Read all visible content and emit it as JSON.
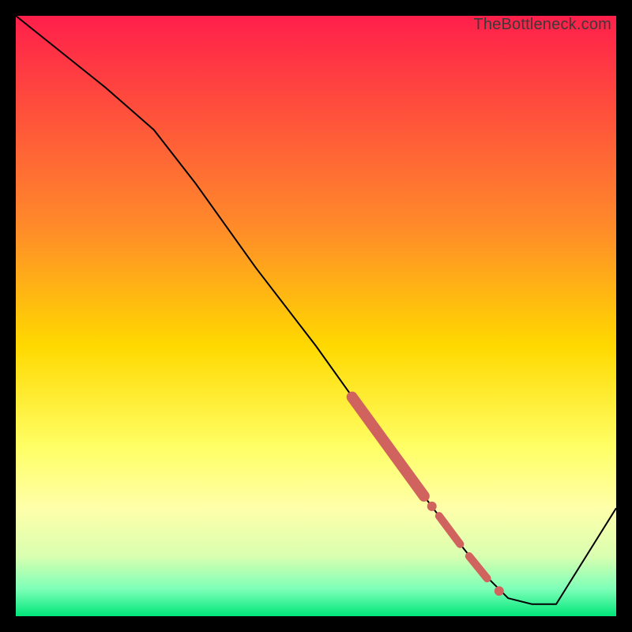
{
  "watermark": "TheBottleneck.com",
  "chart_data": {
    "type": "line",
    "title": "",
    "xlabel": "",
    "ylabel": "",
    "xlim": [
      0,
      100
    ],
    "ylim": [
      0,
      100
    ],
    "gradient_stops": [
      {
        "offset": 0.0,
        "color": "#ff1f4b"
      },
      {
        "offset": 0.35,
        "color": "#ff8a2a"
      },
      {
        "offset": 0.55,
        "color": "#ffd900"
      },
      {
        "offset": 0.72,
        "color": "#ffff66"
      },
      {
        "offset": 0.82,
        "color": "#ffffaa"
      },
      {
        "offset": 0.9,
        "color": "#d9ffb0"
      },
      {
        "offset": 0.955,
        "color": "#7dffb8"
      },
      {
        "offset": 1.0,
        "color": "#00e67a"
      }
    ],
    "series": [
      {
        "name": "bottleneck-curve",
        "color": "#000000",
        "stroke_width": 2,
        "x": [
          0,
          5,
          15,
          23,
          30,
          40,
          50,
          60,
          68,
          74,
          78,
          82,
          86,
          90,
          100
        ],
        "y": [
          100,
          96,
          88,
          81,
          72,
          58,
          45,
          31,
          20,
          12,
          7,
          3,
          2,
          2,
          18
        ]
      }
    ],
    "highlight_segments": [
      {
        "name": "thick-segment",
        "color": "#d1635e",
        "stroke_width": 14,
        "linecap": "round",
        "x": [
          56,
          68
        ],
        "y": [
          36.5,
          20
        ]
      },
      {
        "name": "mid-dash-1",
        "color": "#d1635e",
        "stroke_width": 10,
        "linecap": "round",
        "x": [
          70.5,
          74
        ],
        "y": [
          16.7,
          12
        ]
      },
      {
        "name": "mid-dash-2",
        "color": "#d1635e",
        "stroke_width": 10,
        "linecap": "round",
        "x": [
          75.5,
          78.5
        ],
        "y": [
          10,
          6.3
        ]
      }
    ],
    "highlight_points": [
      {
        "x": 69.3,
        "y": 18.3,
        "r": 6,
        "color": "#d1635e"
      },
      {
        "x": 80.5,
        "y": 4.2,
        "r": 6,
        "color": "#d1635e"
      }
    ]
  }
}
